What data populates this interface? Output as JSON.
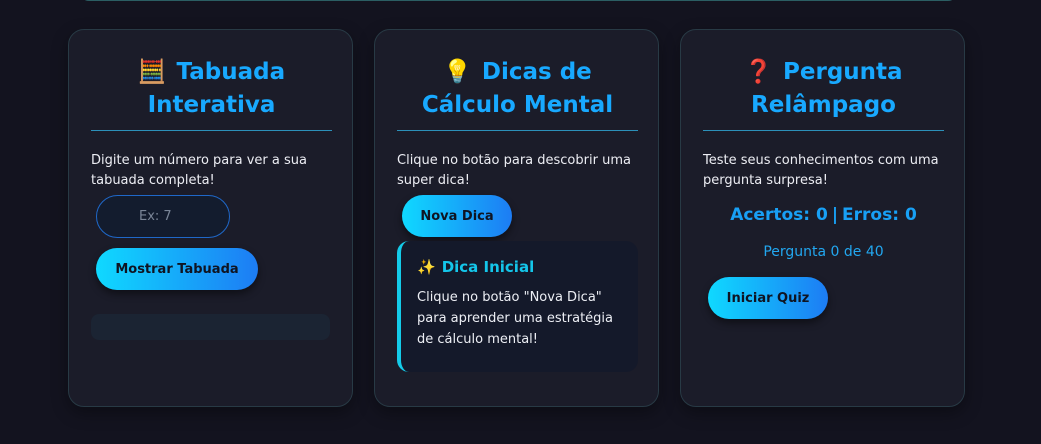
{
  "cards": [
    {
      "icon": "🧮",
      "title": "Tabuada Interativa",
      "description": "Digite um número para ver a sua tabuada completa!",
      "input_placeholder": "Ex: 7",
      "button_label": "Mostrar Tabuada"
    },
    {
      "icon": "💡",
      "title": "Dicas de Cálculo Mental",
      "description": "Clique no botão para descobrir uma super dica!",
      "button_label": "Nova Dica",
      "tip": {
        "icon": "✨",
        "title": "Dica Inicial",
        "text": "Clique no botão \"Nova Dica\" para aprender uma estratégia de cálculo mental!"
      }
    },
    {
      "icon": "❓",
      "title": "Pergunta Relâmpago",
      "description": "Teste seus conhecimentos com uma pergunta surpresa!",
      "score": {
        "hits_label": "Acertos: 0",
        "separator": "|",
        "errors_label": "Erros: 0"
      },
      "progress": "Pergunta 0 de 40",
      "button_label": "Iniciar Quiz"
    }
  ],
  "colors": {
    "background": "#13131f",
    "card": "#1b1c29",
    "accent": "#18a9ff",
    "button_gradient_start": "#0fd9ff",
    "button_gradient_end": "#1d7cf4",
    "tip_accent": "#14cbe9"
  }
}
